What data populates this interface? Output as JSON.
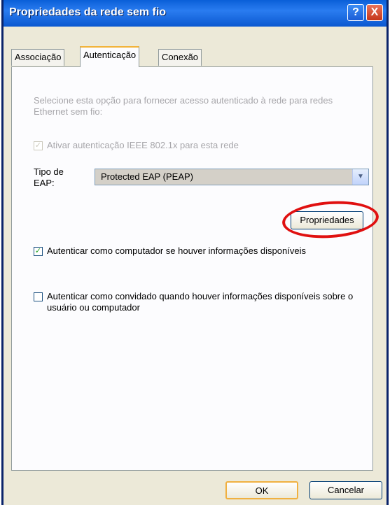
{
  "window": {
    "title": "Propriedades da rede sem fio",
    "help_label": "?",
    "close_label": "X"
  },
  "tabs": [
    {
      "label": "Associação"
    },
    {
      "label": "Autenticação"
    },
    {
      "label": "Conexão"
    }
  ],
  "panel": {
    "description": "Selecione esta opção para fornecer acesso autenticado à rede para redes Ethernet sem fio:",
    "enable_8021x": {
      "label": "Ativar autenticação IEEE 802.1x para esta rede",
      "checked": true,
      "disabled": true
    },
    "eap_type_label": "Tipo de EAP:",
    "eap_type_value": "Protected EAP (PEAP)",
    "properties_button": "Propriedades",
    "auth_as_computer": {
      "label": "Autenticar como computador se houver informações disponíveis",
      "checked": true
    },
    "auth_as_guest": {
      "label": "Autenticar como convidado quando houver informações disponíveis sobre o usuário ou computador",
      "checked": false
    }
  },
  "footer": {
    "ok_label": "OK",
    "cancel_label": "Cancelar"
  },
  "colors": {
    "titlebar": "#0a5fd8",
    "highlight_oval": "#e01010",
    "check": "#21a121"
  }
}
